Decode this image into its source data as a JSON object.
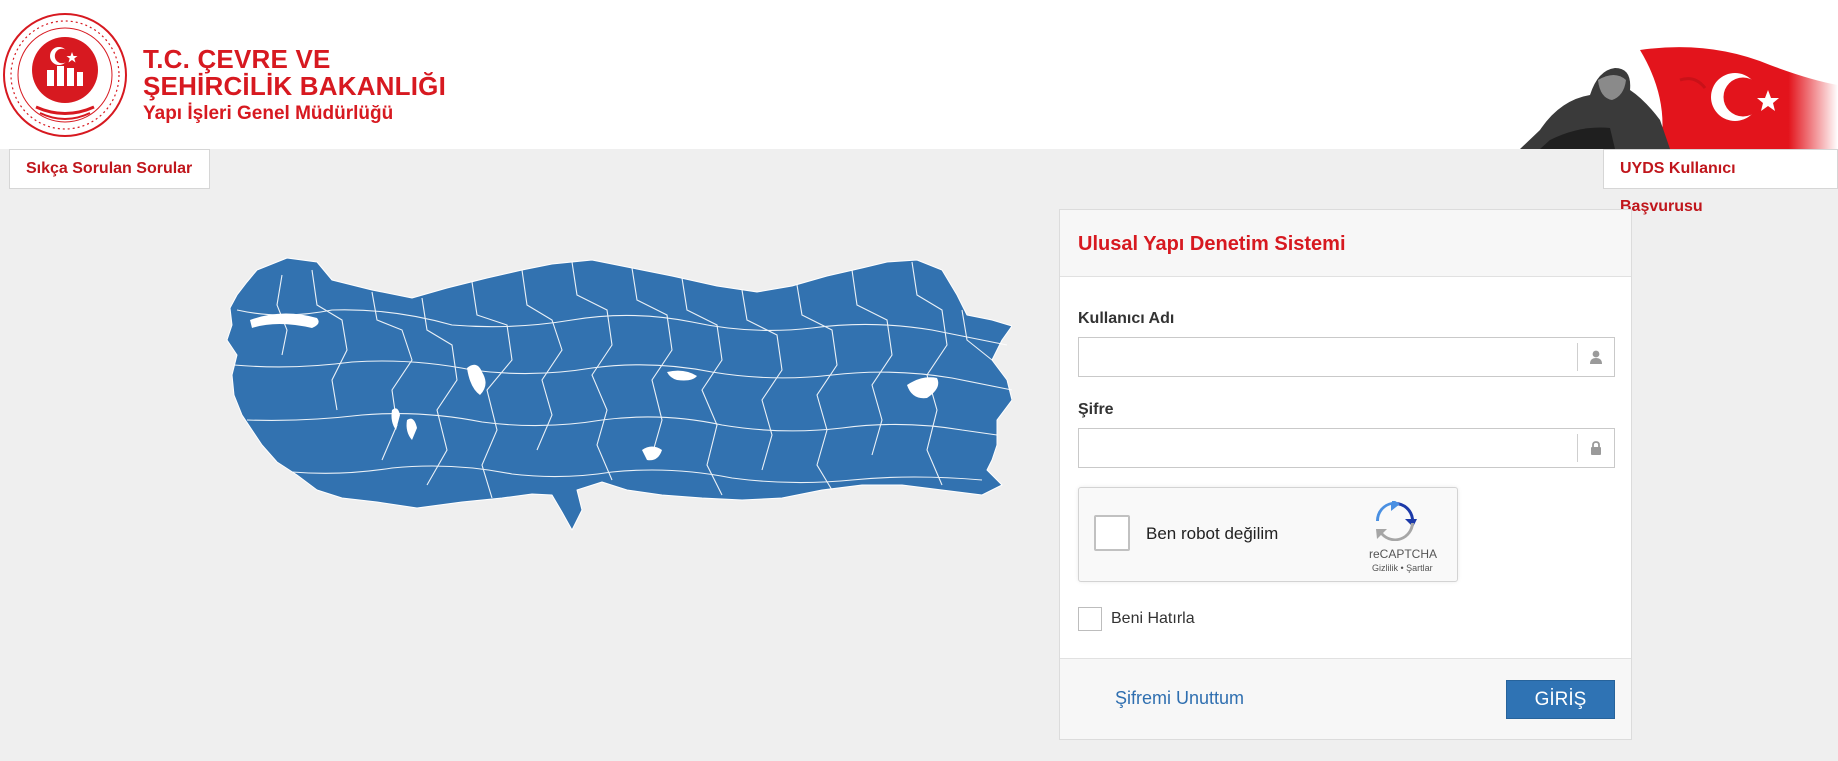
{
  "header": {
    "logo_line1": "T.C. ÇEVRE VE",
    "logo_line2": "ŞEHİRCİLİK BAKANLIĞI",
    "logo_line3": "Yapı İşleri Genel Müdürlüğü"
  },
  "nav": {
    "faq_label": "Sıkça Sorulan Sorular",
    "apply_label": "UYDS Kullanıcı Başvurusu"
  },
  "login": {
    "title": "Ulusal Yapı Denetim Sistemi",
    "username_label": "Kullanıcı Adı",
    "username_value": "",
    "password_label": "Şifre",
    "password_value": "",
    "captcha_label": "Ben robot değilim",
    "captcha_brand": "reCAPTCHA",
    "captcha_links": "Gizlilik • Şartlar",
    "remember_label": "Beni Hatırla",
    "forgot_label": "Şifremi Unuttum",
    "submit_label": "GİRİŞ"
  },
  "icons": {
    "username_icon": "user-icon",
    "password_icon": "lock-icon",
    "captcha_icon": "recaptcha-logo-icon"
  },
  "colors": {
    "brand_red": "#d71920",
    "map_blue": "#3272b0",
    "button_blue": "#2f73b4",
    "link_blue": "#2f6fb0",
    "background": "#efefef"
  }
}
